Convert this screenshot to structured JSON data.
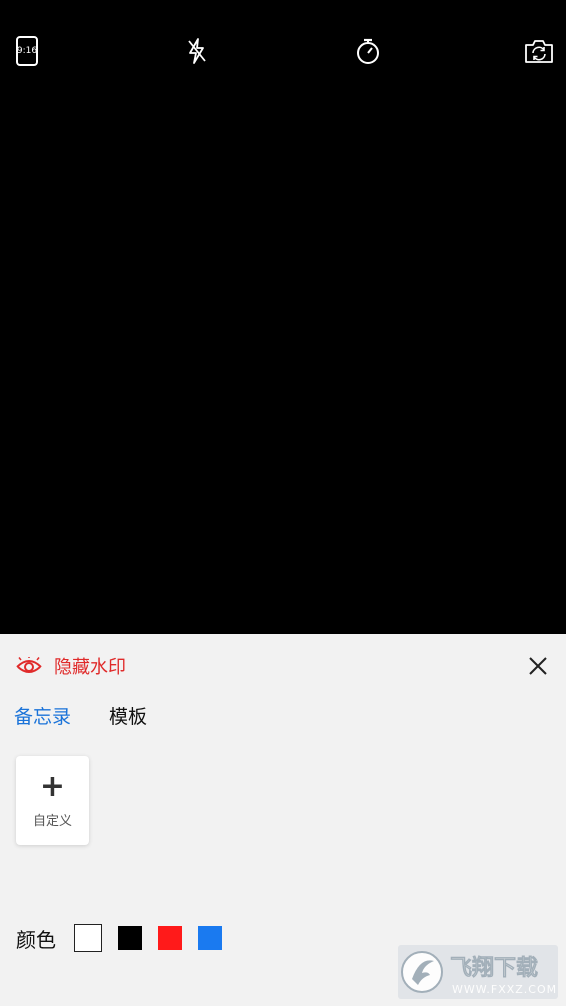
{
  "topbar": {
    "ratio_label": "9:16",
    "icons": [
      "aspect-ratio-icon",
      "flash-off-icon",
      "timer-icon",
      "switch-camera-icon"
    ]
  },
  "panel": {
    "hide_watermark_label": "隐藏水印",
    "tabs": [
      {
        "label": "备忘录",
        "active": true
      },
      {
        "label": "模板",
        "active": false
      }
    ],
    "custom_label": "自定义",
    "color_label": "颜色",
    "colors": [
      "#ffffff",
      "#000000",
      "#ff1a1a",
      "#1a7af0"
    ],
    "accent_red": "#e02a2a",
    "accent_blue": "#1a73d9"
  },
  "watermark": {
    "brand": "飞翔下载",
    "url": "WWW.FXXZ.COM"
  }
}
